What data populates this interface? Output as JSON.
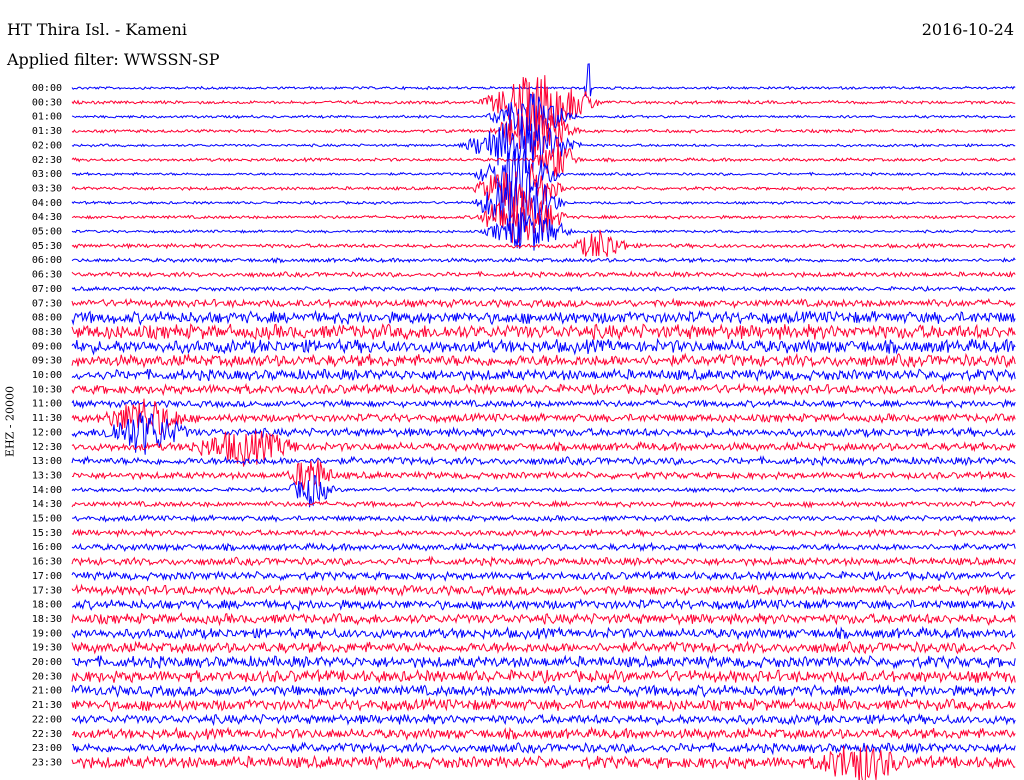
{
  "header": {
    "station": "HT Thira Isl. - Kameni",
    "date": "2016-10-24",
    "filter_label": "Applied filter: WWSSN-SP"
  },
  "colors": {
    "series_a": "#0000ff",
    "series_b": "#ff0033",
    "background": "#ffffff"
  },
  "chart_data": {
    "type": "line",
    "title": "HT Thira Isl. - Kameni",
    "ylabel": "EHZ - 20000",
    "xlabel": "",
    "grid": false,
    "x_span_minutes": [
      0,
      30
    ],
    "tick_labels": [
      "00:00",
      "00:30",
      "01:00",
      "01:30",
      "02:00",
      "02:30",
      "03:00",
      "03:30",
      "04:00",
      "04:30",
      "05:00",
      "05:30",
      "06:00",
      "06:30",
      "07:00",
      "07:30",
      "08:00",
      "08:30",
      "09:00",
      "09:30",
      "10:00",
      "10:30",
      "11:00",
      "11:30",
      "12:00",
      "12:30",
      "13:00",
      "13:30",
      "14:00",
      "14:30",
      "15:00",
      "15:30",
      "16:00",
      "16:30",
      "17:00",
      "17:30",
      "18:00",
      "18:30",
      "19:00",
      "19:30",
      "20:00",
      "20:30",
      "21:00",
      "21:30",
      "22:00",
      "22:30",
      "23:00",
      "23:30"
    ],
    "noise_level": [
      0.1,
      0.12,
      0.1,
      0.12,
      0.1,
      0.12,
      0.1,
      0.12,
      0.1,
      0.12,
      0.1,
      0.15,
      0.15,
      0.18,
      0.15,
      0.28,
      0.45,
      0.55,
      0.5,
      0.45,
      0.4,
      0.35,
      0.25,
      0.3,
      0.3,
      0.3,
      0.28,
      0.25,
      0.15,
      0.2,
      0.2,
      0.22,
      0.25,
      0.28,
      0.3,
      0.35,
      0.35,
      0.38,
      0.38,
      0.4,
      0.42,
      0.45,
      0.4,
      0.42,
      0.35,
      0.38,
      0.35,
      0.45
    ],
    "events": [
      {
        "trace": 0,
        "minute": 16.4,
        "amplitude": 5.0,
        "duration_minutes": 0.1
      },
      {
        "trace": 1,
        "minute": 14.9,
        "amplitude": 3.0,
        "duration_minutes": 2.0
      },
      {
        "trace": 2,
        "minute": 14.6,
        "amplitude": 2.2,
        "duration_minutes": 1.5
      },
      {
        "trace": 3,
        "minute": 14.7,
        "amplitude": 2.5,
        "duration_minutes": 1.5
      },
      {
        "trace": 4,
        "minute": 14.3,
        "amplitude": 2.8,
        "duration_minutes": 2.0
      },
      {
        "trace": 5,
        "minute": 15.4,
        "amplitude": 2.0,
        "duration_minutes": 0.8
      },
      {
        "trace": 6,
        "minute": 14.2,
        "amplitude": 2.5,
        "duration_minutes": 1.5
      },
      {
        "trace": 7,
        "minute": 14.2,
        "amplitude": 3.0,
        "duration_minutes": 1.5
      },
      {
        "trace": 8,
        "minute": 14.2,
        "amplitude": 3.5,
        "duration_minutes": 1.5
      },
      {
        "trace": 9,
        "minute": 14.3,
        "amplitude": 3.0,
        "duration_minutes": 1.5
      },
      {
        "trace": 10,
        "minute": 14.5,
        "amplitude": 2.0,
        "duration_minutes": 1.5
      },
      {
        "trace": 11,
        "minute": 16.8,
        "amplitude": 1.5,
        "duration_minutes": 1.0
      },
      {
        "trace": 23,
        "minute": 2.3,
        "amplitude": 1.8,
        "duration_minutes": 1.5
      },
      {
        "trace": 24,
        "minute": 2.3,
        "amplitude": 2.0,
        "duration_minutes": 1.5
      },
      {
        "trace": 25,
        "minute": 5.5,
        "amplitude": 1.5,
        "duration_minutes": 2.0
      },
      {
        "trace": 27,
        "minute": 7.6,
        "amplitude": 1.8,
        "duration_minutes": 0.8
      },
      {
        "trace": 28,
        "minute": 7.6,
        "amplitude": 1.5,
        "duration_minutes": 0.8
      },
      {
        "trace": 47,
        "minute": 25.0,
        "amplitude": 1.8,
        "duration_minutes": 1.5
      }
    ]
  }
}
